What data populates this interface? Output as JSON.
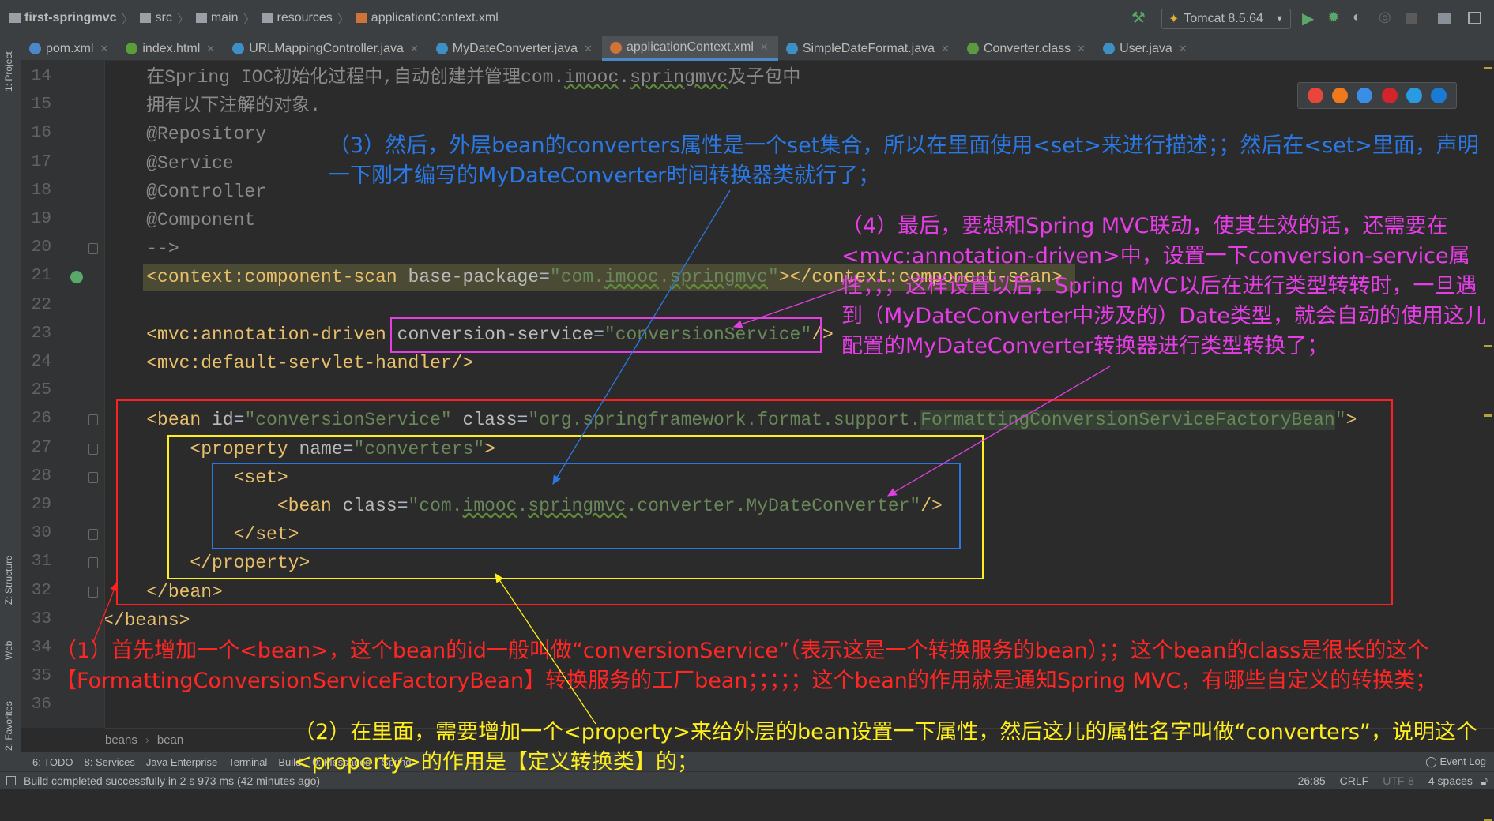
{
  "breadcrumbs": [
    "first-springmvc",
    "src",
    "main",
    "resources",
    "applicationContext.xml"
  ],
  "run_config": "Tomcat 8.5.64",
  "tabs": [
    {
      "label": "pom.xml",
      "icon": "maven-icon",
      "color": "#4a88c7"
    },
    {
      "label": "index.html",
      "icon": "html-file-icon",
      "color": "#5a9e3a"
    },
    {
      "label": "URLMappingController.java",
      "icon": "java-class-icon",
      "color": "#3d8fc4"
    },
    {
      "label": "MyDateConverter.java",
      "icon": "java-class-icon",
      "color": "#3d8fc4"
    },
    {
      "label": "applicationContext.xml",
      "icon": "spring-xml-icon",
      "color": "#d0733a",
      "active": true
    },
    {
      "label": "SimpleDateFormat.java",
      "icon": "java-class-icon",
      "color": "#3d8fc4"
    },
    {
      "label": "Converter.class",
      "icon": "interface-icon",
      "color": "#5c9a3f"
    },
    {
      "label": "User.java",
      "icon": "java-class-icon",
      "color": "#3d8fc4"
    }
  ],
  "left_strip": [
    "1: Project",
    "Z: Structure",
    "Web",
    "2: Favorites"
  ],
  "code": [
    {
      "n": "14",
      "tokens": [
        [
          "c",
          "    在Spring IOC初始化过程中,自动创建并管理com."
        ],
        [
          "c sq",
          "imooc"
        ],
        [
          "c",
          "."
        ],
        [
          "c sq",
          "springmvc"
        ],
        [
          "c",
          "及子包中"
        ]
      ]
    },
    {
      "n": "15",
      "tokens": [
        [
          "c",
          "    拥有以下注解的对象."
        ]
      ]
    },
    {
      "n": "16",
      "tokens": [
        [
          "c",
          "    @Repository"
        ]
      ]
    },
    {
      "n": "17",
      "tokens": [
        [
          "c",
          "    @Service"
        ]
      ]
    },
    {
      "n": "18",
      "tokens": [
        [
          "c",
          "    @Controller"
        ]
      ]
    },
    {
      "n": "19",
      "tokens": [
        [
          "c",
          "    @Component"
        ]
      ]
    },
    {
      "n": "20",
      "tokens": [
        [
          "c",
          "    -->"
        ]
      ]
    },
    {
      "n": "21",
      "tokens": [
        [
          "t",
          "    <context:component-scan"
        ],
        [
          "a",
          " base-package"
        ],
        [
          "p",
          "="
        ],
        [
          "v",
          "\"com."
        ],
        [
          "v sq",
          "imooc"
        ],
        [
          "v",
          "."
        ],
        [
          "v sq",
          "springmvc"
        ],
        [
          "v",
          "\""
        ],
        [
          "t",
          "></context:component-scan>"
        ]
      ]
    },
    {
      "n": "22",
      "tokens": []
    },
    {
      "n": "23",
      "tokens": [
        [
          "t",
          "    <mvc:annotation-driven"
        ],
        [
          "a",
          " conversion-service"
        ],
        [
          "p",
          "="
        ],
        [
          "v",
          "\"conversionService\""
        ],
        [
          "t",
          "/>"
        ]
      ]
    },
    {
      "n": "24",
      "tokens": [
        [
          "t",
          "    <mvc:default-servlet-handler/>"
        ]
      ]
    },
    {
      "n": "25",
      "tokens": []
    },
    {
      "n": "26",
      "tokens": [
        [
          "t",
          "    <bean"
        ],
        [
          "a",
          " id"
        ],
        [
          "p",
          "="
        ],
        [
          "v",
          "\"conversionService\""
        ],
        [
          "a",
          " class"
        ],
        [
          "p",
          "="
        ],
        [
          "v",
          "\"org.springframework.format.support."
        ],
        [
          "v hl",
          "FormattingConversionServiceFactoryBean"
        ],
        [
          "v",
          "\""
        ],
        [
          "t",
          ">"
        ]
      ]
    },
    {
      "n": "27",
      "tokens": [
        [
          "t",
          "        <property"
        ],
        [
          "a",
          " name"
        ],
        [
          "p",
          "="
        ],
        [
          "v",
          "\"converters\""
        ],
        [
          "t",
          ">"
        ]
      ]
    },
    {
      "n": "28",
      "tokens": [
        [
          "t",
          "            <set>"
        ]
      ]
    },
    {
      "n": "29",
      "tokens": [
        [
          "t",
          "                <bean"
        ],
        [
          "a",
          " class"
        ],
        [
          "p",
          "="
        ],
        [
          "v",
          "\"com."
        ],
        [
          "v sq",
          "imooc"
        ],
        [
          "v",
          "."
        ],
        [
          "v sq",
          "springmvc"
        ],
        [
          "v",
          ".converter.MyDateConverter\""
        ],
        [
          "t",
          "/>"
        ]
      ]
    },
    {
      "n": "30",
      "tokens": [
        [
          "t",
          "            </set>"
        ]
      ]
    },
    {
      "n": "31",
      "tokens": [
        [
          "t",
          "        </property>"
        ]
      ]
    },
    {
      "n": "32",
      "tokens": [
        [
          "t",
          "    </bean>"
        ]
      ]
    },
    {
      "n": "33",
      "tokens": [
        [
          "t",
          "</beans>"
        ]
      ]
    },
    {
      "n": "34",
      "tokens": []
    },
    {
      "n": "35",
      "tokens": []
    },
    {
      "n": "36",
      "tokens": []
    }
  ],
  "annotations": {
    "step3": "（3）然后，外层bean的converters属性是一个set集合，所以在里面使用<set>来进行描述；；然后在<set>里面，声明一下刚才编写的MyDateConverter时间转换器类就行了；",
    "step4": "（4）最后，要想和Spring MVC联动，使其生效的话，还需要在<mvc:annotation-driven>中，设置一下conversion-service属性；；；这样设置以后，Spring MVC以后在进行类型转转时，一旦遇到（MyDateConverter中涉及的）Date类型，就会自动的使用这儿配置的MyDateConverter转换器进行类型转换了；",
    "step1": "（1）首先增加一个<bean>，这个bean的id一般叫做“conversionService”（表示这是一个转换服务的bean）；；这个bean的class是很长的这个【FormattingConversionServiceFactoryBean】转换服务的工厂bean；；；；；这个bean的作用就是通知Spring MVC，有哪些自定义的转换类；",
    "step2": "（2）在里面，需要增加一个<property>来给外层的bean设置一下属性，然后这儿的属性名字叫做“converters”，说明这个<property>的作用是【定义转换类】的；"
  },
  "annotation_colors": {
    "step1": "#ff2626",
    "step2": "#ffee1e",
    "step3": "#2a78e4",
    "step4": "#e63ee6"
  },
  "editor_breadcrumb": [
    "beans",
    "bean"
  ],
  "tool_windows": [
    "6: TODO",
    "8: Services",
    "Java Enterprise",
    "Terminal",
    "Build",
    "0: Messages",
    "Spring"
  ],
  "event_log": "Event Log",
  "status": {
    "message": "Build completed successfully in 2 s 973 ms (42 minutes ago)",
    "position": "26:85",
    "line_ending": "CRLF",
    "encoding": "UTF-8",
    "indent": "4 spaces"
  },
  "browsers": [
    {
      "icon": "chrome-icon",
      "color": "#e8453c"
    },
    {
      "icon": "firefox-icon",
      "color": "#f07a1b"
    },
    {
      "icon": "safari-icon",
      "color": "#3a8ee6"
    },
    {
      "icon": "opera-icon",
      "color": "#d3242c"
    },
    {
      "icon": "ie-icon",
      "color": "#2a9be0"
    },
    {
      "icon": "edge-icon",
      "color": "#1a7bd4"
    }
  ]
}
